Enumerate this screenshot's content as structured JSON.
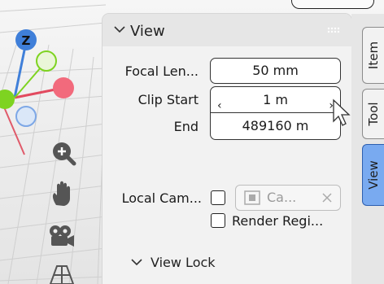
{
  "gizmo": {
    "z_axis_label": "Z"
  },
  "panel": {
    "title": "View",
    "focal_length": {
      "label": "Focal Len...",
      "value": "50 mm"
    },
    "clip_start": {
      "label": "Clip Start",
      "value": "1 m"
    },
    "clip_end": {
      "label": "End",
      "value": "489160 m"
    },
    "local_camera": {
      "label": "Local Cam...",
      "field_text": "Ca..."
    },
    "render_region": {
      "label": "Render Regi..."
    },
    "subpanel_view_lock": "View Lock"
  },
  "tabs": [
    {
      "label": "Item",
      "active": false
    },
    {
      "label": "Tool",
      "active": false
    },
    {
      "label": "View",
      "active": true
    }
  ],
  "colors": {
    "accent_tab": "#79aaf0",
    "z_axis": "#3f7fd9",
    "x_axis": "#e24a5f",
    "y_axis": "#7ed321"
  }
}
